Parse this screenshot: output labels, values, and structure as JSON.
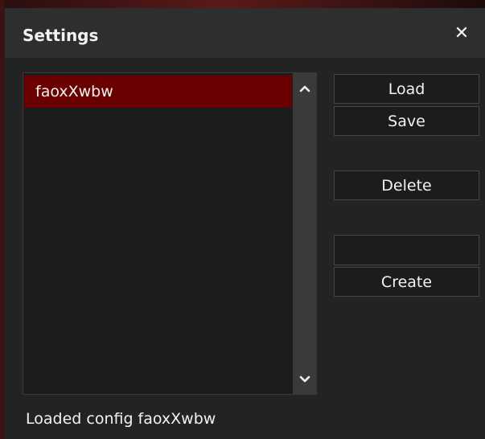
{
  "window": {
    "title": "Settings",
    "close_symbol": "✕"
  },
  "config_list": {
    "items": [
      "faoxXwbw"
    ],
    "selected": "faoxXwbw",
    "scroll_up_icon": "chevron-up-icon",
    "scroll_down_icon": "chevron-down-icon"
  },
  "buttons": {
    "load": "Load",
    "save": "Save",
    "delete": "Delete",
    "create": "Create"
  },
  "new_config_input": {
    "value": "",
    "placeholder": ""
  },
  "status": {
    "message": "Loaded config faoxXwbw"
  },
  "colors": {
    "selection": "#6a0000",
    "accent": "#5a1a1a",
    "background": "#232323"
  }
}
